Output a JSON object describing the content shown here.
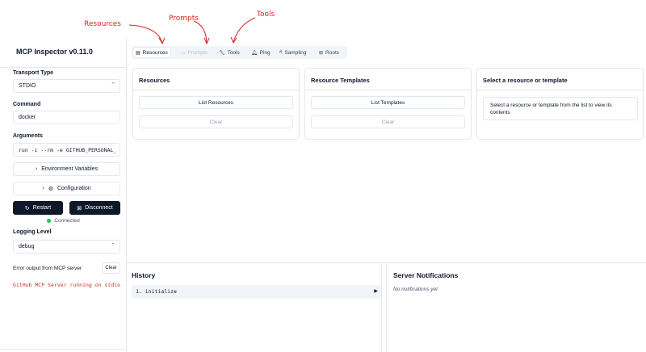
{
  "annotations": {
    "resources": "Resources",
    "prompts": "Prompts",
    "tools": "Tools",
    "color": "#dc2626"
  },
  "sidebar": {
    "title": "MCP Inspector v0.11.0",
    "transport_label": "Transport Type",
    "transport_value": "STDIO",
    "command_label": "Command",
    "command_value": "docker",
    "arguments_label": "Arguments",
    "arguments_value": "run -i --rm -e GITHUB_PERSONAL_",
    "env_button": "Environment Variables",
    "config_button": "Configuration",
    "restart_button": "Restart",
    "disconnect_button": "Disconnect",
    "status": "Connected",
    "logging_label": "Logging Level",
    "logging_value": "debug",
    "error_label": "Error output from MCP server",
    "error_clear": "Clear",
    "error_output": "GitHub MCP Server running on stdio"
  },
  "tabs": [
    {
      "label": "Resources",
      "icon": "resources-icon"
    },
    {
      "label": "Prompts",
      "icon": "message-icon"
    },
    {
      "label": "Tools",
      "icon": "wrench-icon"
    },
    {
      "label": "Ping",
      "icon": "bell-icon"
    },
    {
      "label": "Sampling",
      "icon": "hash-icon"
    },
    {
      "label": "Roots",
      "icon": "folder-tree-icon"
    }
  ],
  "resources_card": {
    "title": "Resources",
    "list_button": "List Resources",
    "clear_button": "Clear"
  },
  "templates_card": {
    "title": "Resource Templates",
    "list_button": "List Templates",
    "clear_button": "Clear"
  },
  "detail_card": {
    "title": "Select a resource or template",
    "message": "Select a resource or template from the list to view its contents"
  },
  "history": {
    "title": "History",
    "items": [
      "1. initialize"
    ]
  },
  "notifications": {
    "title": "Server Notifications",
    "empty": "No notifications yet"
  },
  "colors": {
    "accent": "#0f172a",
    "connected": "#22c55e",
    "error": "#dc2626"
  }
}
